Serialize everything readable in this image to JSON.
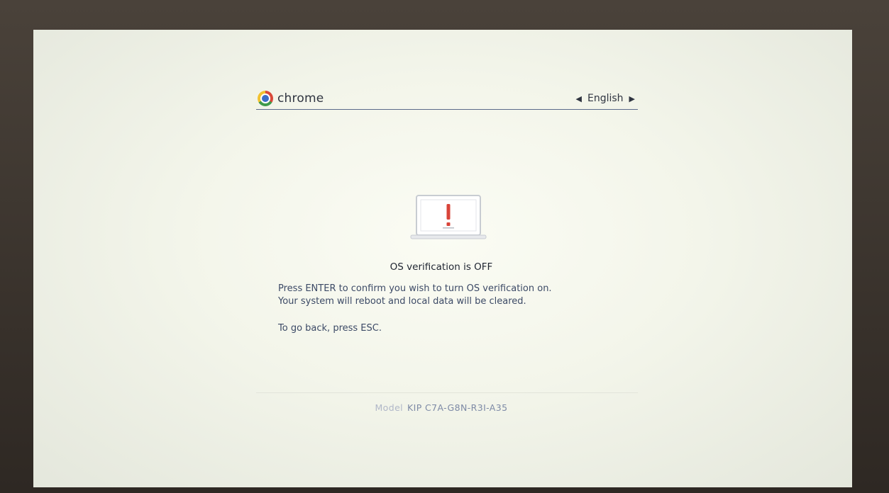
{
  "header": {
    "brand": "chrome",
    "language": "English",
    "prev_language_icon": "triangle-left",
    "next_language_icon": "triangle-right"
  },
  "main": {
    "illustration_icon": "laptop-warning-icon",
    "title": "OS verification is OFF",
    "instructions": [
      "Press ENTER to confirm you wish to turn OS verification on.",
      "Your system will reboot and local data will be cleared.",
      "To go back, press ESC."
    ]
  },
  "footer": {
    "model_label": "Model",
    "model_value": "KIP C7A-G8N-R3I-A35"
  },
  "colors": {
    "accent_text": "#3c4a66",
    "warning_red": "#d9443a",
    "screen_bg": "#f6f7ee"
  }
}
